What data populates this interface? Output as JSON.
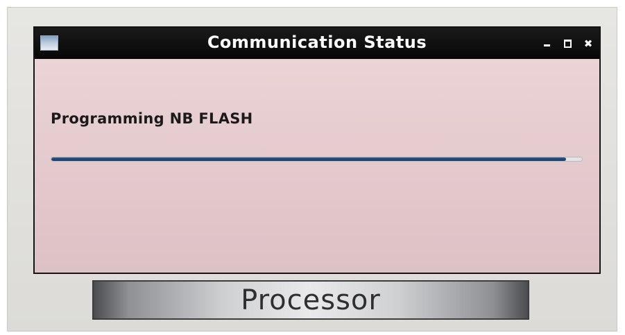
{
  "background_app": {
    "button_label": "Processor"
  },
  "dialog": {
    "title": "Communication Status",
    "icon": "window-icon",
    "controls": {
      "minimize_icon": "minimize-icon",
      "maximize_icon": "maximize-icon",
      "close_icon": "close-icon",
      "close_glyph": "✖"
    },
    "status_message": "Programming NB FLASH",
    "progress_fraction": 0.97
  },
  "colors": {
    "titlebar": "#0b0b0b",
    "dialog_body": "#e9cfd2",
    "progress_fill": "#1f4676"
  }
}
